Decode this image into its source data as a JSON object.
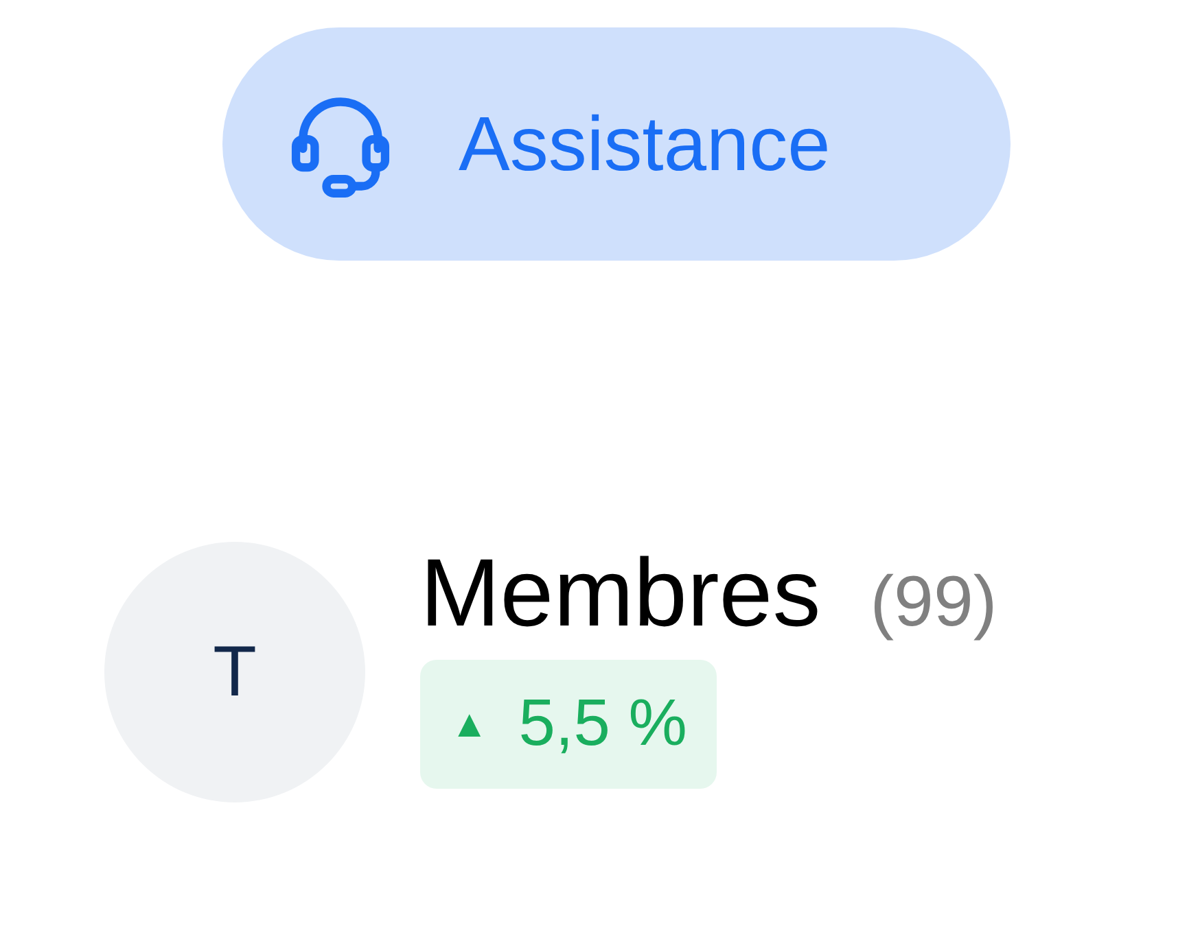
{
  "support_button": {
    "label": "Assistance"
  },
  "member": {
    "avatar_initial": "T",
    "title": "Membres",
    "count": "(99)",
    "trend": {
      "positive": true,
      "arrow": "▲",
      "value": "5,5 %"
    }
  }
}
